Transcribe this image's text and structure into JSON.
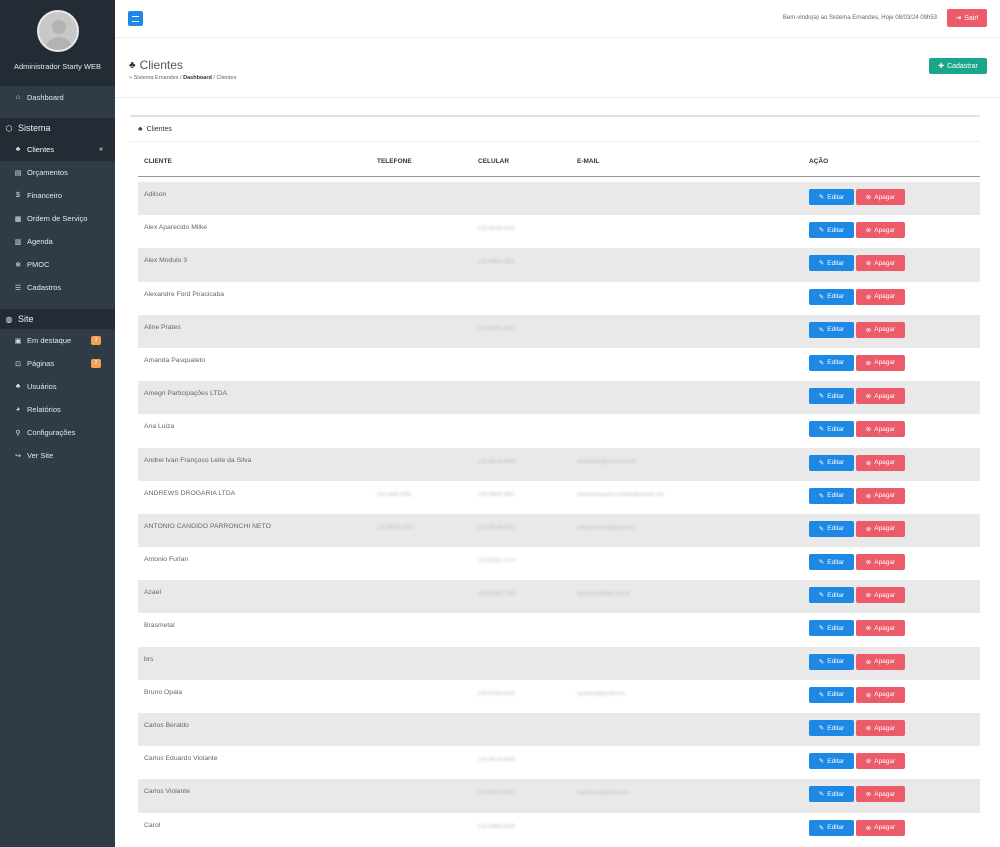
{
  "sidebar": {
    "user_name": "Administrador Starty WEB",
    "dashboard": "Dashboard",
    "sistema_title": "Sistema",
    "sistema_items": [
      {
        "label": "Clientes",
        "icon": "users-icon"
      },
      {
        "label": "Orçamentos",
        "icon": "file-icon"
      },
      {
        "label": "Financeiro",
        "icon": "dollar-icon"
      },
      {
        "label": "Ordem de Serviço",
        "icon": "document-icon"
      },
      {
        "label": "Agenda",
        "icon": "calendar-icon"
      },
      {
        "label": "PMOC",
        "icon": "snowflake-icon"
      },
      {
        "label": "Cadastros",
        "icon": "list-icon"
      }
    ],
    "site_title": "Site",
    "site_items": [
      {
        "label": "Em destaque",
        "icon": "image-icon",
        "badge": "3"
      },
      {
        "label": "Páginas",
        "icon": "pages-icon",
        "badge": "2"
      },
      {
        "label": "Usuários",
        "icon": "users-icon"
      },
      {
        "label": "Relatórios",
        "icon": "chart-icon"
      },
      {
        "label": "Configurações",
        "icon": "wrench-icon"
      },
      {
        "label": "Ver Site",
        "icon": "share-icon"
      }
    ]
  },
  "header": {
    "welcome": "Bem-vindo(a) ao Sistema Ernandes, Hoje 08/03/24 09h53",
    "logout_label": "Sair!"
  },
  "page": {
    "title": "Clientes",
    "crumb_home": "» Sistema Ernandes",
    "crumb_dashboard": "Dashboard",
    "crumb_current": "Clientes",
    "add_label": "Cadastrar"
  },
  "panel": {
    "title": "Clientes",
    "columns": {
      "cliente": "CLIENTE",
      "telefone": "TELEFONE",
      "celular": "CELULAR",
      "email": "E-MAIL",
      "acao": "AÇÃO"
    },
    "edit_label": "Editar",
    "delete_label": "Apagar",
    "rows": [
      {
        "name": "Adilson",
        "telefone": "",
        "celular": "",
        "email": ""
      },
      {
        "name": "Alex Aparecido Milke",
        "telefone": "",
        "celular": "(19) 99795-5510",
        "email": ""
      },
      {
        "name": "Alex Modulo 3",
        "telefone": "",
        "celular": "(19) 99893-2001",
        "email": ""
      },
      {
        "name": "Alexandre Ford Piracicaba",
        "telefone": "",
        "celular": "",
        "email": ""
      },
      {
        "name": "Aline Prates",
        "telefone": "",
        "celular": "(19) 99321-4000",
        "email": ""
      },
      {
        "name": "Amanda Pasqualeto",
        "telefone": "",
        "celular": "",
        "email": ""
      },
      {
        "name": "Amegn Participações LTDA",
        "telefone": "",
        "celular": "",
        "email": ""
      },
      {
        "name": "Ana Luiza",
        "telefone": "",
        "celular": "",
        "email": ""
      },
      {
        "name": "Andrei Ivan Françoso Leite da Silva",
        "telefone": "",
        "celular": "(19) 98136-0000",
        "email": "andreileite@yahoo.com.br"
      },
      {
        "name": "ANDREWS DROGARIA LTDA",
        "telefone": "(19) 3449-5000",
        "celular": "(19) 99830-4821",
        "email": "andrewsdrogaria.contato@hotmail.com"
      },
      {
        "name": "ANTONIO CANDIDO PARRONCHI NETO",
        "telefone": "(19) 98716-2021",
        "celular": "(19) 98749-0472",
        "email": "netoparronchi@gmail.com"
      },
      {
        "name": "Antonio Furlan",
        "telefone": "",
        "celular": "(19) 99162-1770",
        "email": ""
      },
      {
        "name": "Azael",
        "telefone": "",
        "celular": "(19) 99385-1788",
        "email": "azael@azaelfilm.com.br"
      },
      {
        "name": "Brasmetal",
        "telefone": "",
        "celular": "",
        "email": ""
      },
      {
        "name": "brs",
        "telefone": "",
        "celular": "",
        "email": ""
      },
      {
        "name": "Bruno Opala",
        "telefone": "",
        "celular": "(19) 97364-4205",
        "email": "opalaoza@gmail.com"
      },
      {
        "name": "Carlos Beraldo",
        "telefone": "",
        "celular": "",
        "email": ""
      },
      {
        "name": "Carlos Eduardo Violante",
        "telefone": "",
        "celular": "(19) 99179-6000",
        "email": ""
      },
      {
        "name": "Carlos Violante",
        "telefone": "",
        "celular": "(19) 99179-6000",
        "email": "violantecar@gmail.com"
      },
      {
        "name": "Carol",
        "telefone": "",
        "celular": "(19) 99863-4300",
        "email": ""
      }
    ]
  },
  "colors": {
    "primary": "#1e88e5",
    "danger": "#ec5b6a",
    "success": "#1aa68a",
    "sidebar": "#2f3b47",
    "badge": "#f0a44b"
  }
}
